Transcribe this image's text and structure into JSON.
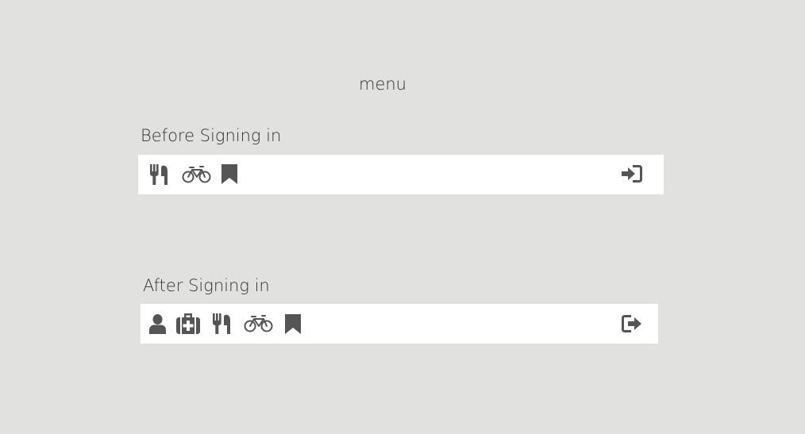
{
  "page": {
    "title": "menu"
  },
  "before_signin": {
    "label": "Before Signing in",
    "left_icons": [
      "restaurant-icon",
      "bicycle-icon",
      "bookmark-icon"
    ],
    "right_icons": [
      "sign-in-icon"
    ]
  },
  "after_signin": {
    "label": "After Signing in",
    "left_icons": [
      "user-icon",
      "medkit-icon",
      "restaurant-icon",
      "bicycle-icon",
      "bookmark-icon"
    ],
    "right_icons": [
      "sign-out-icon"
    ]
  },
  "colors": {
    "background": "#e1e1e0",
    "bar": "#ffffff",
    "icon": "#555555",
    "text": "#333333"
  }
}
